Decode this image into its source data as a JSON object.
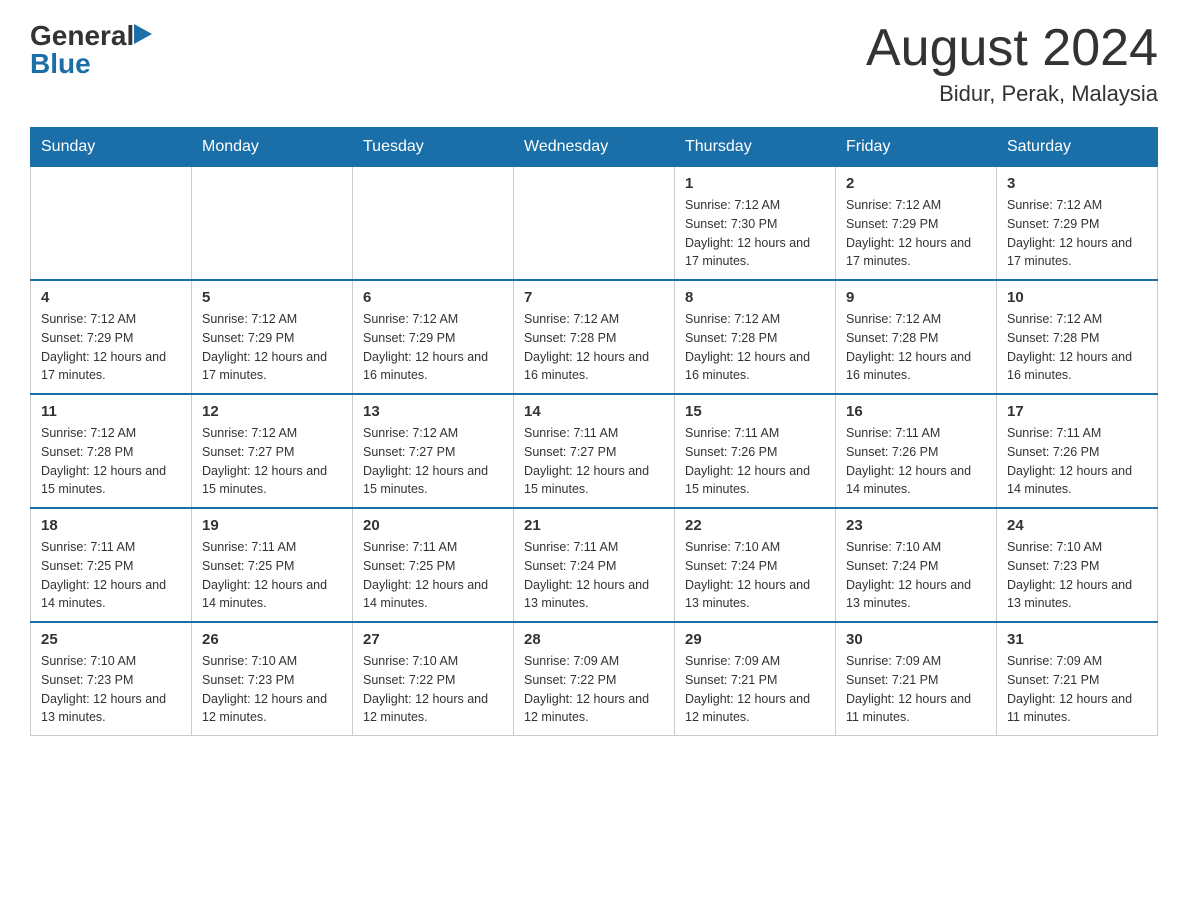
{
  "header": {
    "logo_general": "General",
    "logo_blue": "Blue",
    "title": "August 2024",
    "subtitle": "Bidur, Perak, Malaysia"
  },
  "days_of_week": [
    "Sunday",
    "Monday",
    "Tuesday",
    "Wednesday",
    "Thursday",
    "Friday",
    "Saturday"
  ],
  "weeks": [
    {
      "days": [
        {
          "number": "",
          "info": ""
        },
        {
          "number": "",
          "info": ""
        },
        {
          "number": "",
          "info": ""
        },
        {
          "number": "",
          "info": ""
        },
        {
          "number": "1",
          "info": "Sunrise: 7:12 AM\nSunset: 7:30 PM\nDaylight: 12 hours and 17 minutes."
        },
        {
          "number": "2",
          "info": "Sunrise: 7:12 AM\nSunset: 7:29 PM\nDaylight: 12 hours and 17 minutes."
        },
        {
          "number": "3",
          "info": "Sunrise: 7:12 AM\nSunset: 7:29 PM\nDaylight: 12 hours and 17 minutes."
        }
      ]
    },
    {
      "days": [
        {
          "number": "4",
          "info": "Sunrise: 7:12 AM\nSunset: 7:29 PM\nDaylight: 12 hours and 17 minutes."
        },
        {
          "number": "5",
          "info": "Sunrise: 7:12 AM\nSunset: 7:29 PM\nDaylight: 12 hours and 17 minutes."
        },
        {
          "number": "6",
          "info": "Sunrise: 7:12 AM\nSunset: 7:29 PM\nDaylight: 12 hours and 16 minutes."
        },
        {
          "number": "7",
          "info": "Sunrise: 7:12 AM\nSunset: 7:28 PM\nDaylight: 12 hours and 16 minutes."
        },
        {
          "number": "8",
          "info": "Sunrise: 7:12 AM\nSunset: 7:28 PM\nDaylight: 12 hours and 16 minutes."
        },
        {
          "number": "9",
          "info": "Sunrise: 7:12 AM\nSunset: 7:28 PM\nDaylight: 12 hours and 16 minutes."
        },
        {
          "number": "10",
          "info": "Sunrise: 7:12 AM\nSunset: 7:28 PM\nDaylight: 12 hours and 16 minutes."
        }
      ]
    },
    {
      "days": [
        {
          "number": "11",
          "info": "Sunrise: 7:12 AM\nSunset: 7:28 PM\nDaylight: 12 hours and 15 minutes."
        },
        {
          "number": "12",
          "info": "Sunrise: 7:12 AM\nSunset: 7:27 PM\nDaylight: 12 hours and 15 minutes."
        },
        {
          "number": "13",
          "info": "Sunrise: 7:12 AM\nSunset: 7:27 PM\nDaylight: 12 hours and 15 minutes."
        },
        {
          "number": "14",
          "info": "Sunrise: 7:11 AM\nSunset: 7:27 PM\nDaylight: 12 hours and 15 minutes."
        },
        {
          "number": "15",
          "info": "Sunrise: 7:11 AM\nSunset: 7:26 PM\nDaylight: 12 hours and 15 minutes."
        },
        {
          "number": "16",
          "info": "Sunrise: 7:11 AM\nSunset: 7:26 PM\nDaylight: 12 hours and 14 minutes."
        },
        {
          "number": "17",
          "info": "Sunrise: 7:11 AM\nSunset: 7:26 PM\nDaylight: 12 hours and 14 minutes."
        }
      ]
    },
    {
      "days": [
        {
          "number": "18",
          "info": "Sunrise: 7:11 AM\nSunset: 7:25 PM\nDaylight: 12 hours and 14 minutes."
        },
        {
          "number": "19",
          "info": "Sunrise: 7:11 AM\nSunset: 7:25 PM\nDaylight: 12 hours and 14 minutes."
        },
        {
          "number": "20",
          "info": "Sunrise: 7:11 AM\nSunset: 7:25 PM\nDaylight: 12 hours and 14 minutes."
        },
        {
          "number": "21",
          "info": "Sunrise: 7:11 AM\nSunset: 7:24 PM\nDaylight: 12 hours and 13 minutes."
        },
        {
          "number": "22",
          "info": "Sunrise: 7:10 AM\nSunset: 7:24 PM\nDaylight: 12 hours and 13 minutes."
        },
        {
          "number": "23",
          "info": "Sunrise: 7:10 AM\nSunset: 7:24 PM\nDaylight: 12 hours and 13 minutes."
        },
        {
          "number": "24",
          "info": "Sunrise: 7:10 AM\nSunset: 7:23 PM\nDaylight: 12 hours and 13 minutes."
        }
      ]
    },
    {
      "days": [
        {
          "number": "25",
          "info": "Sunrise: 7:10 AM\nSunset: 7:23 PM\nDaylight: 12 hours and 13 minutes."
        },
        {
          "number": "26",
          "info": "Sunrise: 7:10 AM\nSunset: 7:23 PM\nDaylight: 12 hours and 12 minutes."
        },
        {
          "number": "27",
          "info": "Sunrise: 7:10 AM\nSunset: 7:22 PM\nDaylight: 12 hours and 12 minutes."
        },
        {
          "number": "28",
          "info": "Sunrise: 7:09 AM\nSunset: 7:22 PM\nDaylight: 12 hours and 12 minutes."
        },
        {
          "number": "29",
          "info": "Sunrise: 7:09 AM\nSunset: 7:21 PM\nDaylight: 12 hours and 12 minutes."
        },
        {
          "number": "30",
          "info": "Sunrise: 7:09 AM\nSunset: 7:21 PM\nDaylight: 12 hours and 11 minutes."
        },
        {
          "number": "31",
          "info": "Sunrise: 7:09 AM\nSunset: 7:21 PM\nDaylight: 12 hours and 11 minutes."
        }
      ]
    }
  ]
}
